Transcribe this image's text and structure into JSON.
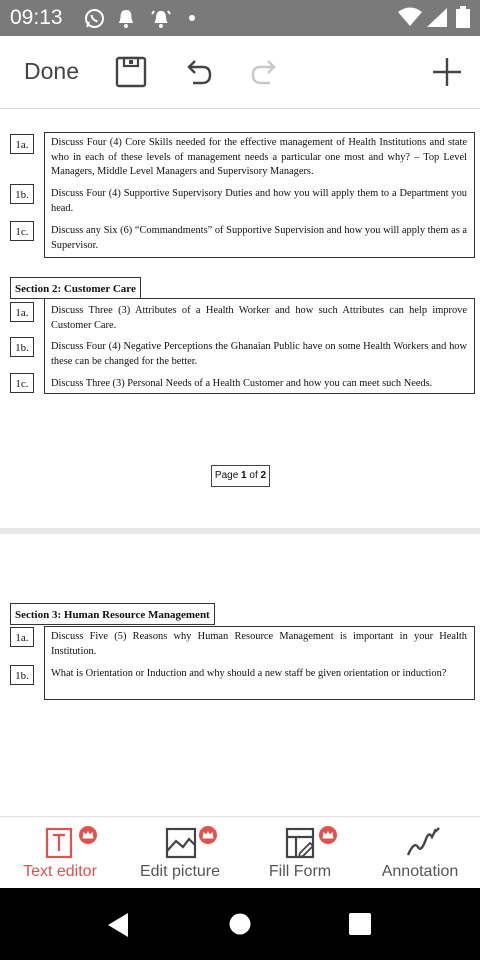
{
  "status_bar": {
    "time": "09:13",
    "icons": [
      "whatsapp-icon",
      "bell-icon",
      "alarm-icon",
      "dot-icon",
      "wifi-icon",
      "signal-icon",
      "battery-icon"
    ]
  },
  "toolbar": {
    "done_label": "Done",
    "icons": [
      "save-icon",
      "undo-icon",
      "redo-icon",
      "add-icon"
    ]
  },
  "document": {
    "page1_items": [
      {
        "num": "1a.",
        "text": "Discuss Four (4) Core Skills needed for the effective management of Health Institutions and state who in each of these levels of management needs a particular one most and why? – Top Level Managers, Middle Level Managers and Supervisory Managers."
      },
      {
        "num": "1b.",
        "text": "Discuss Four (4) Supportive Supervisory Duties and how you will apply them to a Department you head."
      },
      {
        "num": "1c.",
        "text": "Discuss any Six (6) “Commandments” of Supportive Supervision and how you will apply them as a Supervisor."
      }
    ],
    "section2": {
      "title": "Section 2: Customer Care",
      "items": [
        {
          "num": "1a.",
          "text": "Discuss Three (3) Attributes of a Health Worker and how such Attributes can help improve Customer Care."
        },
        {
          "num": "1b.",
          "text": "Discuss Four (4) Negative Perceptions the Ghanaian Public have on some Health Workers and how these can be changed for the better."
        },
        {
          "num": "1c.",
          "text": "Discuss Three (3) Personal Needs of a Health Customer and how you can meet such Needs."
        }
      ]
    },
    "page_indicator": {
      "prefix": "Page ",
      "current": "1",
      "middle": " of ",
      "total": "2"
    },
    "section3": {
      "title": "Section 3: Human Resource Management",
      "items": [
        {
          "num": "1a.",
          "text": "Discuss Five (5) Reasons why Human Resource Management is important in your Health Institution."
        },
        {
          "num": "1b.",
          "text": "What is Orientation or Induction and why should a new staff be given orientation or induction?"
        }
      ]
    }
  },
  "bottom_tools": [
    {
      "label": "Text editor",
      "active": true,
      "icon": "text-editor-icon"
    },
    {
      "label": "Edit picture",
      "active": false,
      "icon": "edit-picture-icon"
    },
    {
      "label": "Fill Form",
      "active": false,
      "icon": "fill-form-icon"
    },
    {
      "label": "Annotation",
      "active": false,
      "icon": "annotation-icon"
    }
  ],
  "colors": {
    "accent": "#e0524f",
    "status_bar": "#7a7a7a",
    "nav_bar": "#000000"
  },
  "nav_bar": {
    "icons": [
      "back-icon",
      "home-icon",
      "recents-icon"
    ]
  }
}
